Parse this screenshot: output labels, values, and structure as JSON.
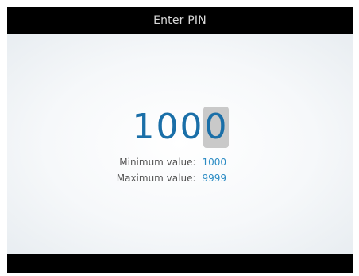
{
  "header": {
    "title": "Enter PIN"
  },
  "pin": {
    "digits": [
      "1",
      "0",
      "0",
      "0"
    ],
    "active_index": 3,
    "text_color": "#1a6fa8"
  },
  "range": {
    "min_label": "Minimum value:",
    "min_value": "1000",
    "max_label": "Maximum value:",
    "max_value": "9999",
    "value_color": "#2c8cc4"
  }
}
